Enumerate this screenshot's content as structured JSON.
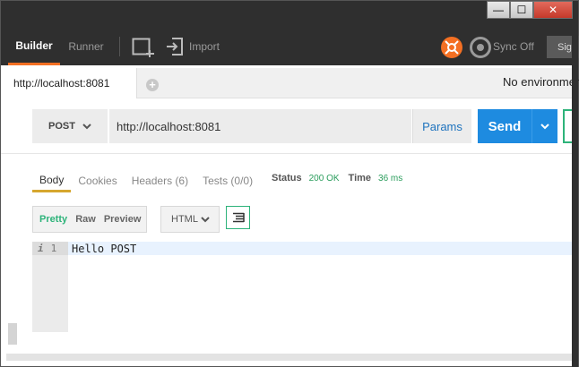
{
  "window": {
    "minimize_glyph": "—",
    "maximize_glyph": "☐",
    "close_glyph": "✕"
  },
  "header": {
    "tabs": [
      {
        "label": "Builder",
        "active": true
      },
      {
        "label": "Runner",
        "active": false
      }
    ],
    "import_label": "Import",
    "sync_label": "Sync Off",
    "sign_label": "Sign",
    "accent_color": "#f47023"
  },
  "request_tabs": {
    "active_tab": "http://localhost:8081",
    "add_glyph": "+",
    "environment": "No environment"
  },
  "request": {
    "method": "POST",
    "url": "http://localhost:8081",
    "params_label": "Params",
    "send_label": "Send",
    "send_color": "#1e8be0"
  },
  "response": {
    "tabs": [
      {
        "label": "Body",
        "active": true
      },
      {
        "label": "Cookies",
        "active": false
      },
      {
        "label": "Headers (6)",
        "active": false
      },
      {
        "label": "Tests (0/0)",
        "active": false
      }
    ],
    "status_label": "Status",
    "status_value": "200 OK",
    "time_label": "Time",
    "time_value": "36 ms",
    "views": [
      "Pretty",
      "Raw",
      "Preview"
    ],
    "active_view": "Pretty",
    "format": "HTML",
    "lines": [
      {
        "marker": "i",
        "number": "1",
        "text": "Hello POST"
      }
    ]
  }
}
